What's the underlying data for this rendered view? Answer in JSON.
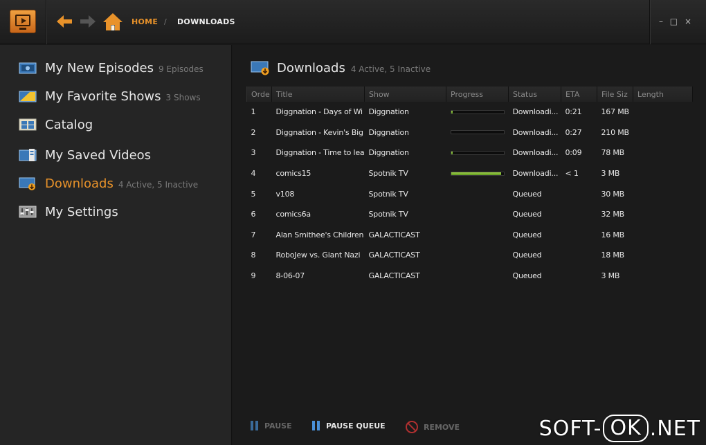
{
  "titlebar": {
    "breadcrumb": {
      "home": "HOME",
      "separator": "/",
      "current": "DOWNLOADS"
    },
    "window_controls": {
      "minimize": "–",
      "maximize": "□",
      "close": "×"
    },
    "icons": {
      "logo": "tv-logo-icon",
      "back": "back-arrow-icon",
      "forward": "forward-arrow-icon",
      "home": "home-icon"
    },
    "accent_color": "#e8922a"
  },
  "sidebar": {
    "items": [
      {
        "label": "My New Episodes",
        "count": "9 Episodes",
        "icon": "new-episodes-icon",
        "active": false
      },
      {
        "label": "My Favorite Shows",
        "count": "3 Shows",
        "icon": "favorite-shows-icon",
        "active": false
      },
      {
        "label": "Catalog",
        "count": "",
        "icon": "catalog-icon",
        "active": false
      },
      {
        "label": "My Saved Videos",
        "count": "",
        "icon": "saved-videos-icon",
        "active": false
      },
      {
        "label": "Downloads",
        "count": "4 Active, 5 Inactive",
        "icon": "downloads-icon",
        "active": true
      },
      {
        "label": "My Settings",
        "count": "",
        "icon": "settings-icon",
        "active": false
      }
    ]
  },
  "main": {
    "title": "Downloads",
    "subtitle": "4 Active, 5 Inactive",
    "columns": [
      "Orde",
      "Title",
      "Show",
      "Progress",
      "Status",
      "ETA",
      "File Siz",
      "Length"
    ],
    "rows": [
      {
        "order": "1",
        "title": "Diggnation - Days of Wi",
        "show": "Diggnation",
        "progress": 0.02,
        "status": "Downloadi...",
        "eta": "0:21",
        "size": "167 MB",
        "length": ""
      },
      {
        "order": "2",
        "title": "Diggnation - Kevin's Big",
        "show": "Diggnation",
        "progress": 0.0,
        "status": "Downloadi...",
        "eta": "0:27",
        "size": "210 MB",
        "length": ""
      },
      {
        "order": "3",
        "title": "Diggnation - Time to lea",
        "show": "Diggnation",
        "progress": 0.03,
        "status": "Downloadi...",
        "eta": "0:09",
        "size": "78 MB",
        "length": ""
      },
      {
        "order": "4",
        "title": "comics15",
        "show": "Spotnik TV",
        "progress": 0.95,
        "status": "Downloadi...",
        "eta": "< 1",
        "size": "3 MB",
        "length": ""
      },
      {
        "order": "5",
        "title": "v108",
        "show": "Spotnik TV",
        "progress": null,
        "status": "Queued",
        "eta": "",
        "size": "30 MB",
        "length": ""
      },
      {
        "order": "6",
        "title": "comics6a",
        "show": "Spotnik TV",
        "progress": null,
        "status": "Queued",
        "eta": "",
        "size": "32 MB",
        "length": ""
      },
      {
        "order": "7",
        "title": "Alan Smithee's Children",
        "show": "GALACTICAST",
        "progress": null,
        "status": "Queued",
        "eta": "",
        "size": "16 MB",
        "length": ""
      },
      {
        "order": "8",
        "title": "RoboJew vs. Giant Nazi",
        "show": "GALACTICAST",
        "progress": null,
        "status": "Queued",
        "eta": "",
        "size": "18 MB",
        "length": ""
      },
      {
        "order": "9",
        "title": "8-06-07",
        "show": "GALACTICAST",
        "progress": null,
        "status": "Queued",
        "eta": "",
        "size": "3 MB",
        "length": ""
      }
    ]
  },
  "toolbar": {
    "pause_label": "PAUSE",
    "pause_queue_label": "PAUSE QUEUE",
    "remove_label": "REMOVE"
  },
  "watermark": {
    "left": "SOFT-",
    "boxed": "OK",
    "right": ".NET"
  }
}
